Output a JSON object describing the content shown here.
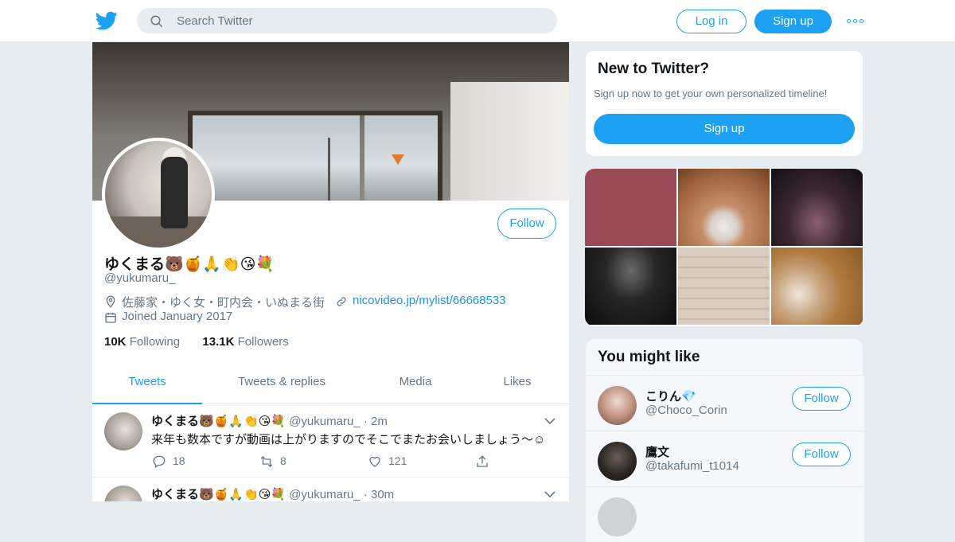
{
  "header": {
    "search_placeholder": "Search Twitter",
    "login_label": "Log in",
    "signup_label": "Sign up"
  },
  "profile": {
    "name": "ゆくまる🐻🍯🙏👏😘💐",
    "handle": "@yukumaru_",
    "location": "佐藤家・ゆく女・町内会・いぬまる街",
    "url": "nicovideo.jp/mylist/66668533",
    "joined": "Joined January 2017",
    "following_count": "10K",
    "following_label": "Following",
    "followers_count": "13.1K",
    "followers_label": "Followers",
    "follow_label": "Follow"
  },
  "tabs": [
    "Tweets",
    "Tweets & replies",
    "Media",
    "Likes"
  ],
  "tweets": [
    {
      "name": "ゆくまる🐻🍯🙏👏😘💐",
      "handle": "@yukumaru_",
      "time": "· 2m",
      "text": "来年も数本ですが動画は上がりますのでそこでまたお会いしましょう〜☺",
      "replies": "18",
      "retweets": "8",
      "likes": "121"
    },
    {
      "name": "ゆくまる🐻🍯🙏👏😘💐",
      "handle": "@yukumaru_",
      "time": "· 30m"
    }
  ],
  "new_to_twitter": {
    "title": "New to Twitter?",
    "subtitle": "Sign up now to get your own personalized timeline!",
    "button": "Sign up"
  },
  "you_might_like": {
    "title": "You might like",
    "users": [
      {
        "name": "こりん💎",
        "handle": "@Choco_Corin",
        "follow": "Follow"
      },
      {
        "name": "鷹文",
        "handle": "@takafumi_t1014",
        "follow": "Follow"
      }
    ]
  },
  "colors": {
    "accent": "#1da1f2",
    "background": "#e6ecf0",
    "text_secondary": "#657786"
  }
}
